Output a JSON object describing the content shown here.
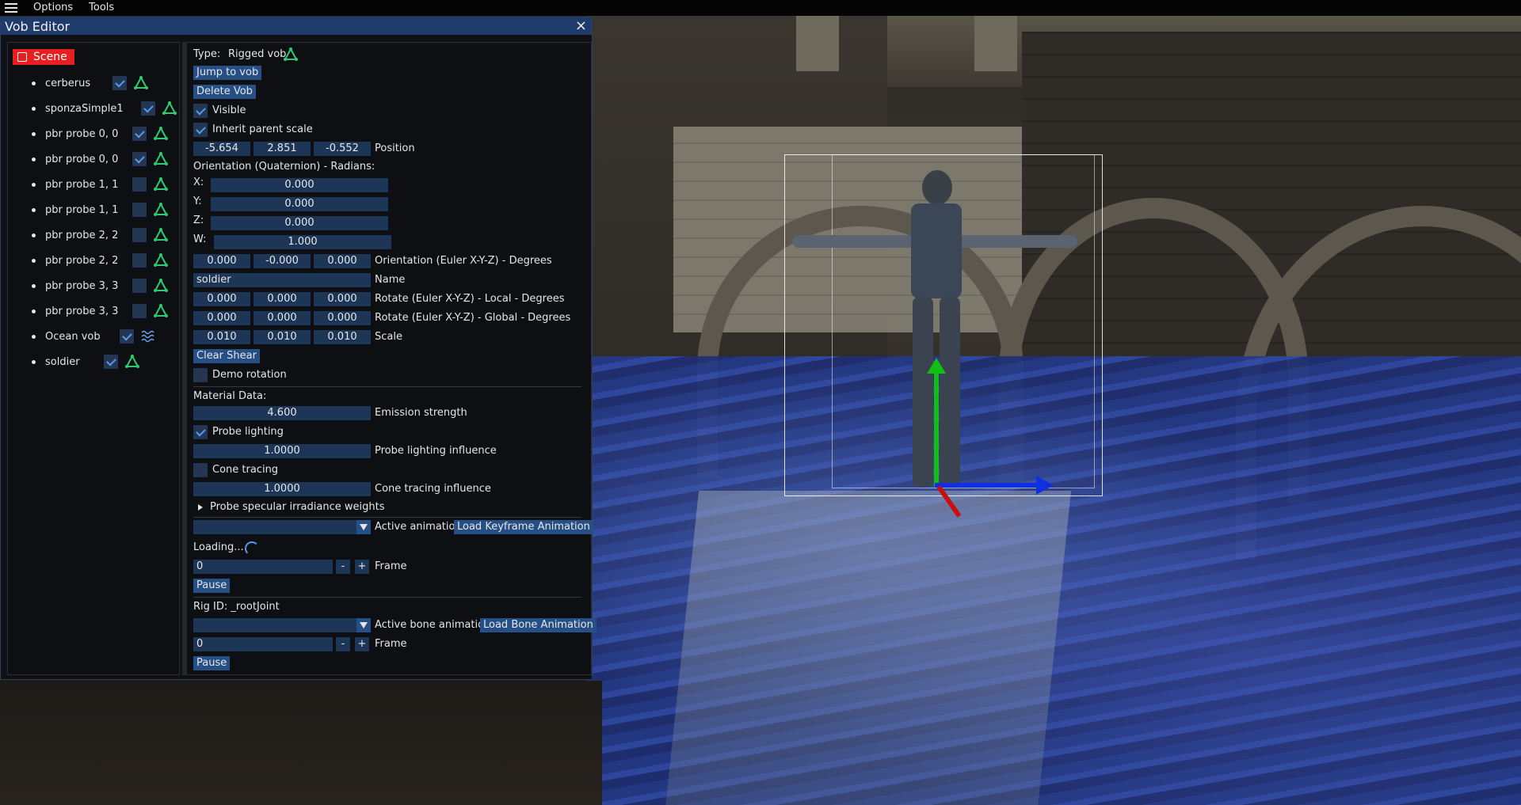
{
  "menubar": {
    "options": "Options",
    "tools": "Tools"
  },
  "window": {
    "title": "Vob Editor",
    "close": "×"
  },
  "scene": {
    "header": "Scene",
    "items": [
      {
        "label": "cerberus",
        "visible": true,
        "icon": "rig-triangle-icon"
      },
      {
        "label": "sponzaSimple1",
        "visible": true,
        "icon": "rig-triangle-icon"
      },
      {
        "label": "pbr probe 0, 0",
        "visible": true,
        "icon": "rig-triangle-icon"
      },
      {
        "label": "pbr probe 0, 0",
        "visible": true,
        "icon": "rig-triangle-icon"
      },
      {
        "label": "pbr probe 1, 1",
        "visible": false,
        "icon": "rig-triangle-icon"
      },
      {
        "label": "pbr probe 1, 1",
        "visible": false,
        "icon": "rig-triangle-icon"
      },
      {
        "label": "pbr probe 2, 2",
        "visible": false,
        "icon": "rig-triangle-icon"
      },
      {
        "label": "pbr probe 2, 2",
        "visible": false,
        "icon": "rig-triangle-icon"
      },
      {
        "label": "pbr probe 3, 3",
        "visible": false,
        "icon": "rig-triangle-icon"
      },
      {
        "label": "pbr probe 3, 3",
        "visible": false,
        "icon": "rig-triangle-icon"
      },
      {
        "label": "Ocean vob",
        "visible": true,
        "icon": "water-waves-icon"
      },
      {
        "label": "soldier",
        "visible": true,
        "icon": "rig-triangle-icon"
      }
    ]
  },
  "props": {
    "type_label": "Type:",
    "type_value": "Rigged vob",
    "jump_to_vob": "Jump to vob",
    "delete_vob": "Delete Vob",
    "visible_label": "Visible",
    "visible": true,
    "inherit_scale_label": "Inherit parent scale",
    "inherit_scale": true,
    "position": {
      "x": "-5.654",
      "y": "2.851",
      "z": "-0.552",
      "label": "Position"
    },
    "orientation_quat_title": "Orientation (Quaternion) - Radians:",
    "quat": {
      "x_label": "X:",
      "x": "0.000",
      "y_label": "Y:",
      "y": "0.000",
      "z_label": "Z:",
      "z": "0.000",
      "w_label": "W:",
      "w": "1.000"
    },
    "euler": {
      "x": "0.000",
      "y": "-0.000",
      "z": "0.000",
      "label": "Orientation (Euler X-Y-Z) - Degrees"
    },
    "name": {
      "value": "soldier",
      "label": "Name"
    },
    "rotate_local": {
      "x": "0.000",
      "y": "0.000",
      "z": "0.000",
      "label": "Rotate (Euler X-Y-Z) - Local - Degrees"
    },
    "rotate_global": {
      "x": "0.000",
      "y": "0.000",
      "z": "0.000",
      "label": "Rotate (Euler X-Y-Z) - Global - Degrees"
    },
    "scale": {
      "x": "0.010",
      "y": "0.010",
      "z": "0.010",
      "label": "Scale"
    },
    "clear_shear": "Clear Shear",
    "demo_rotation_label": "Demo rotation",
    "demo_rotation": false
  },
  "material": {
    "title": "Material Data:",
    "emission_value": "4.600",
    "emission_label": "Emission strength",
    "probe_lighting_label": "Probe lighting",
    "probe_lighting": true,
    "probe_influence_value": "1.0000",
    "probe_influence_label": "Probe lighting influence",
    "cone_tracing_label": "Cone tracing",
    "cone_tracing": false,
    "cone_influence_value": "1.0000",
    "cone_influence_label": "Cone tracing influence",
    "probe_specular_label": "Probe specular irradiance weights"
  },
  "animation": {
    "active_label": "Active animation",
    "load_keyframe": "Load Keyframe Animation",
    "loading": "Loading...",
    "frame_value": "0",
    "frame_label": "Frame",
    "minus": "-",
    "plus": "+",
    "pause": "Pause"
  },
  "bone": {
    "rig_id": "Rig ID: _rootJoint",
    "active_label": "Active bone animation",
    "load_bone": "Load Bone Animation",
    "frame_value": "0",
    "frame_label": "Frame",
    "minus": "-",
    "plus": "+",
    "pause": "Pause"
  },
  "colors": {
    "title_bar": "#1f3b6b",
    "scene_header": "#e62020",
    "button": "#264f85",
    "field": "#1d3557",
    "check": "#4f9cf2",
    "rig_icon": "#2ecc71"
  }
}
